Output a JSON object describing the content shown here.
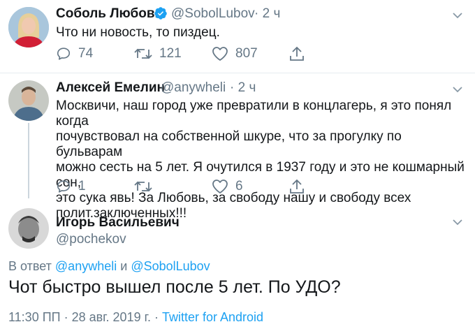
{
  "tweet1": {
    "name": "Соболь Любовь",
    "handle": "@SobolLubov",
    "time": "· 2 ч",
    "text": "Что ни новость, то пиздец.",
    "reply_count": "74",
    "retweet_count": "121",
    "like_count": "807"
  },
  "tweet2": {
    "name": "Алексей Емелин",
    "handle": "@anywheli",
    "time": "· 2 ч",
    "text_lines": [
      "Москвичи, наш город уже превратили в концлагерь, я это понял когда",
      "почувствовал на собственной шкуре, что за прогулку по бульварам",
      "можно сесть на 5 лет. Я очутился в 1937 году и это не кошмарный сон,",
      "это сука явь! За Любовь, за свободу нашу и свободу всех",
      "полит.заключенных!!!"
    ],
    "reply_count": "1",
    "like_count": "6"
  },
  "tweet3": {
    "name": "Игорь Васильевич",
    "handle": "@pochekov",
    "reply_prefix": "В ответ",
    "reply_to_1": "@anywheli",
    "reply_and": "и",
    "reply_to_2": "@SobolLubov",
    "text": "Чот быстро вышел после 5 лет. По УДО?",
    "timestamp": "11:30 ПП · 28 авг. 2019 г. ·",
    "source": "Twitter for Android"
  },
  "colors": {
    "primary_text": "#14171a",
    "secondary_text": "#657786",
    "link": "#1da1f2",
    "verified": "#1da1f2",
    "divider": "#e6ecf0"
  },
  "icons": [
    "reply-icon",
    "retweet-icon",
    "like-icon",
    "share-icon",
    "chevron-down-icon",
    "verified-badge-icon"
  ]
}
